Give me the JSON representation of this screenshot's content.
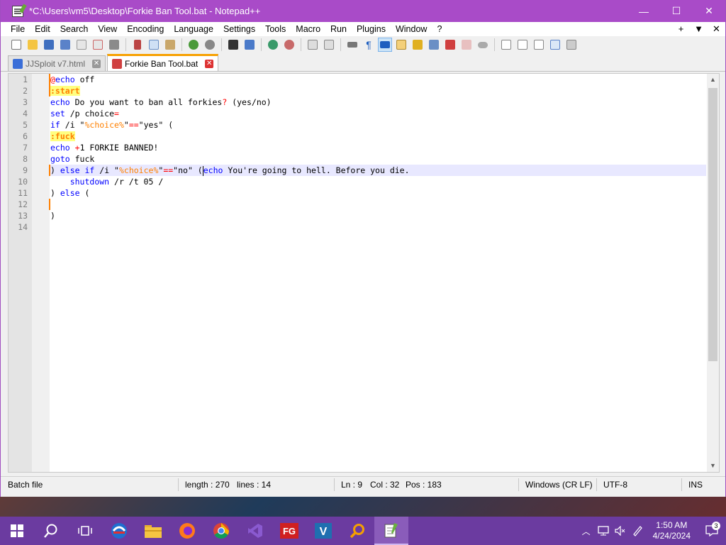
{
  "window": {
    "title": "*C:\\Users\\vm5\\Desktop\\Forkie Ban Tool.bat - Notepad++",
    "minimize": "—",
    "maximize": "☐",
    "close": "✕"
  },
  "menu": {
    "items": [
      "File",
      "Edit",
      "Search",
      "View",
      "Encoding",
      "Language",
      "Settings",
      "Tools",
      "Macro",
      "Run",
      "Plugins",
      "Window",
      "?"
    ],
    "right": [
      "+",
      "▼",
      "✕"
    ]
  },
  "toolbar": {
    "icons": [
      "new-file",
      "open-file",
      "save",
      "save-all",
      "close",
      "close-all",
      "print",
      "cut",
      "copy",
      "paste",
      "undo",
      "redo",
      "find",
      "replace",
      "zoom-in",
      "zoom-out",
      "sync-vertical",
      "sync-horizontal",
      "word-wrap",
      "show-all-chars",
      "indent-guide",
      "udl",
      "doc-map",
      "function-list",
      "folder-workspace",
      "monitoring",
      "record-macro",
      "stop-record",
      "play-macro",
      "run-multiple",
      "save-macro"
    ]
  },
  "tabs": [
    {
      "label": "JJSploit v7.html",
      "icon_color": "#3a6ed8",
      "active": false
    },
    {
      "label": "Forkie Ban Tool.bat",
      "icon_color": "#d04040",
      "active": true
    }
  ],
  "editor": {
    "line_numbers": [
      "1",
      "2",
      "3",
      "4",
      "5",
      "6",
      "7",
      "8",
      "9",
      "10",
      "11",
      "12",
      "13",
      "14"
    ],
    "current_line": 9
  },
  "statusbar": {
    "language": "Batch file",
    "length": "length : 270",
    "lines": "lines : 14",
    "ln": "Ln : 9",
    "col": "Col : 32",
    "pos": "Pos : 183",
    "eol": "Windows (CR LF)",
    "encoding": "UTF-8",
    "mode": "INS"
  },
  "taskbar": {
    "apps": [
      "start",
      "search",
      "task-view",
      "edge",
      "file-explorer",
      "firefox",
      "chrome",
      "visual-studio",
      "fg-app",
      "v-app",
      "search-app",
      "notepad-plus-plus"
    ],
    "clock_time": "1:50 AM",
    "clock_date": "4/24/2024",
    "notification_count": "3"
  }
}
